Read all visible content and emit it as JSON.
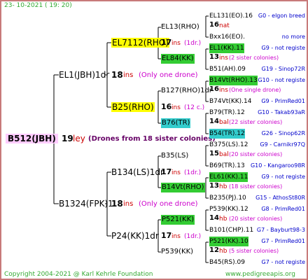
{
  "header_date": "23- 10-2021 ( 19: 20)",
  "footer_copyright": "Copyright 2004-2021 @ Karl Kehrle Foundation",
  "footer_url": "www.pedigreeapis.org",
  "colors": {
    "pink_bg": "#ffccff",
    "yellow_bg": "#ffff00",
    "green_bg": "#33cc33",
    "cyan_bg": "#33cccc",
    "red_text": "#cc0000",
    "blue_text": "#0000cc",
    "purple_text": "#cc00cc",
    "dark_purple": "#660066"
  },
  "root": {
    "name": "B512(JBH)",
    "num": "19",
    "suffix": "ley",
    "note": "(Drones from 18 sister colonies)"
  },
  "gen1": [
    {
      "name": "EL1(JBH)1dr",
      "num": "18",
      "suffix": "ins",
      "note": "(Only one drone)"
    },
    {
      "name": "B1324(FPK)1",
      "num": "18",
      "suffix": "ins",
      "note": "(Only one drone)"
    }
  ],
  "gen2": [
    {
      "name": "EL7112(RHO)",
      "num": "17",
      "suffix": "ins",
      "note": "(1dr.)"
    },
    {
      "name": "B25(RHO)",
      "num": "16",
      "suffix": "ins",
      "note": "(12 c.)"
    },
    {
      "name": "B134(LS)1dr",
      "num": "17",
      "suffix": "ins",
      "note": "(1dr.)"
    },
    {
      "name": "P24(KK)1dr",
      "num": "17",
      "suffix": "ins",
      "note": "(1dr.)"
    }
  ],
  "gen3": [
    {
      "name": "EL13(RHO)"
    },
    {
      "name": "EL84(KK)"
    },
    {
      "name": "B127(RHO)1dr",
      "num": "16",
      "suffix": "ins",
      "note": "(One single drone)"
    },
    {
      "name": "B76(TR)"
    },
    {
      "name": "B35(LS)"
    },
    {
      "name": "B14Vt(RHO)"
    },
    {
      "name": "P521(KK)"
    },
    {
      "name": "P539(KK)"
    }
  ],
  "gen4": [
    {
      "name": "EL131(EO).16",
      "loc": "G0 - elgon breed"
    },
    {
      "name": "16",
      "suffix": "nat"
    },
    {
      "name": "Bxx16(EO).",
      "loc": "no more"
    },
    {
      "name": "EL1(KK).11",
      "loc": "G9 - not registe"
    },
    {
      "name": "13",
      "suffix": "ins",
      "note": "(2 sister colonies)"
    },
    {
      "name": "B51(AH).09",
      "loc": "G19 - Sinop72R"
    },
    {
      "name": "B14Vt(RHO).13",
      "loc": "G10 - not registe"
    },
    {
      "name": "16",
      "suffix": "ins",
      "note": "(One single drone)"
    },
    {
      "name": "B74Vt(KK).14",
      "loc": "G9 - PrimRed01"
    },
    {
      "name": "B79(TR).12",
      "loc": "G10 - Takab93aR"
    },
    {
      "name": "14",
      "suffix": "bal",
      "note": "(22 sister colonies)"
    },
    {
      "name": "B54(TR).12",
      "loc": "G26 - Sinop62R"
    },
    {
      "name": "B375(LS).12",
      "loc": "G9 - Carnikr97Q"
    },
    {
      "name": "15",
      "suffix": "bal",
      "note": "(20 sister colonies)"
    },
    {
      "name": "B69(TR).13",
      "loc": "G10 - Kangaroo98R"
    },
    {
      "name": "EL61(KK).11",
      "loc": "G9 - not registe"
    },
    {
      "name": "13",
      "suffix": "hb",
      "note": "(18 sister colonies)"
    },
    {
      "name": "B235(PJ).10",
      "loc": "G15 - AthosSt80R"
    },
    {
      "name": "P539(KK).12",
      "loc": "G8 - PrimRed01"
    },
    {
      "name": "14",
      "suffix": "hb",
      "note": "(20 sister colonies)"
    },
    {
      "name": "B101(CHP).11",
      "loc": "G7 - Bayburt98-3"
    },
    {
      "name": "P521(KK).10",
      "loc": "G7 - PrimRed01"
    },
    {
      "name": "12",
      "suffix": "hb",
      "note": "(5 sister colonies)"
    },
    {
      "name": "B45(RS).09",
      "loc": "G7 - not registe"
    }
  ]
}
